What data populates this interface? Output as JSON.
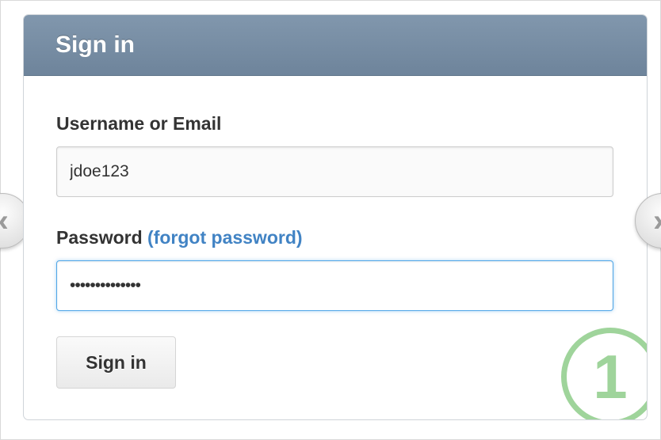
{
  "header": {
    "title": "Sign in"
  },
  "form": {
    "username_label": "Username or Email",
    "username_value": "jdoe123",
    "password_label": "Password",
    "forgot_link": "(forgot password)",
    "password_value": "••••••••••••••",
    "submit_label": "Sign in"
  },
  "step_badge": "1",
  "icons": {
    "prev": "chevron-left-icon",
    "next": "chevron-right-icon"
  },
  "colors": {
    "header": "#7890a6",
    "link": "#4183c4",
    "focus": "#51a7e8",
    "badge": "#8fcd8a"
  }
}
